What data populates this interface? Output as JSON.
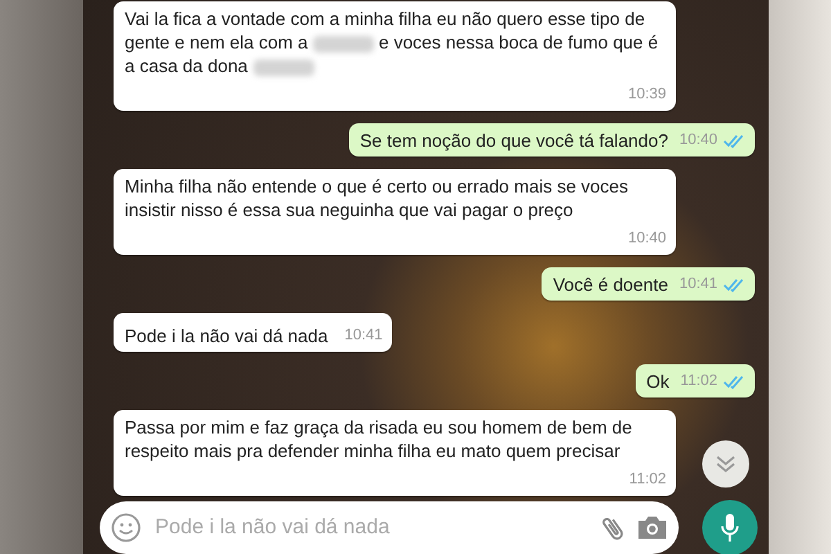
{
  "messages": [
    {
      "kind": "received",
      "parts": [
        {
          "kind": "text",
          "text": "Vai la fica a vontade com a minha filha eu não quero esse tipo de gente e nem ela com a "
        },
        {
          "kind": "redacted"
        },
        {
          "kind": "text",
          "text": " e voces nessa boca de fumo que é a casa da dona "
        },
        {
          "kind": "redacted"
        }
      ],
      "time": "10:39"
    },
    {
      "kind": "sent",
      "parts": [
        {
          "kind": "text",
          "text": "Se tem noção do que você tá falando?"
        }
      ],
      "time": "10:40",
      "read": true
    },
    {
      "kind": "received",
      "parts": [
        {
          "kind": "text",
          "text": "Minha filha não entende o que é certo ou errado mais se voces insistir nisso é essa sua neguinha que vai pagar o preço"
        }
      ],
      "time": "10:40"
    },
    {
      "kind": "sent",
      "parts": [
        {
          "kind": "text",
          "text": "Você é doente"
        }
      ],
      "time": "10:41",
      "read": true
    },
    {
      "kind": "received",
      "parts": [
        {
          "kind": "text",
          "text": "Pode i la não vai dá nada"
        }
      ],
      "time": "10:41"
    },
    {
      "kind": "sent",
      "parts": [
        {
          "kind": "text",
          "text": "Ok"
        }
      ],
      "time": "11:02",
      "read": true
    },
    {
      "kind": "received",
      "parts": [
        {
          "kind": "text",
          "text": "Passa por mim e faz graça da risada eu sou homem de bem de respeito mais pra defender minha filha eu mato quem precisar"
        }
      ],
      "time": "11:02"
    }
  ],
  "composer": {
    "placeholder": "Pode i la não vai dá nada"
  }
}
